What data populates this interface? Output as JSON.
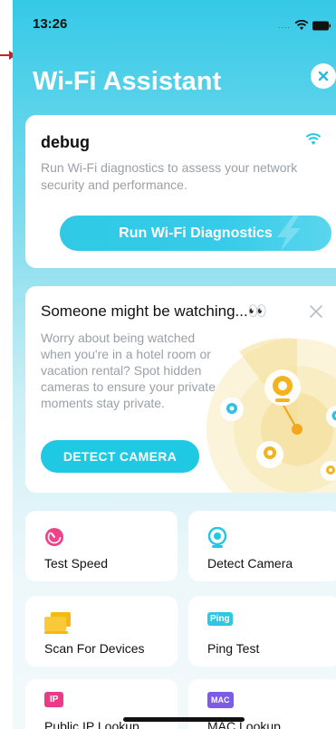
{
  "status_bar": {
    "time": "13:26",
    "dots": "....",
    "icons": [
      "wifi-icon",
      "battery-icon"
    ]
  },
  "header": {
    "title": "Wi-Fi Assistant",
    "close_icon": "close-icon"
  },
  "network_card": {
    "network_name": "debug",
    "description": "Run Wi-Fi diagnostics to assess your network security and performance.",
    "run_button_label": "Run Wi-Fi Diagnostics"
  },
  "camera_card": {
    "title": "Someone might be watching...👀",
    "description": "Worry about being watched when you're in a hotel room or vacation rental? Spot hidden cameras to ensure your private moments stay private.",
    "button_label": "DETECT CAMERA"
  },
  "tools": [
    {
      "label": "Test Speed",
      "icon": "speedometer-icon"
    },
    {
      "label": "Detect Camera",
      "icon": "camera-icon"
    },
    {
      "label": "Scan For Devices",
      "icon": "devices-icon"
    },
    {
      "label": "Ping Test",
      "icon": "ping-icon",
      "badge": "Ping"
    },
    {
      "label": "Public IP Lookup",
      "icon": "ip-icon",
      "badge": "IP"
    },
    {
      "label": "MAC Lookup",
      "icon": "mac-icon",
      "badge": "MAC"
    }
  ],
  "colors": {
    "accent": "#1fc8e3",
    "speed": "#f0428a",
    "devices": "#f6b90e",
    "ip": "#ea3b8b"
  }
}
